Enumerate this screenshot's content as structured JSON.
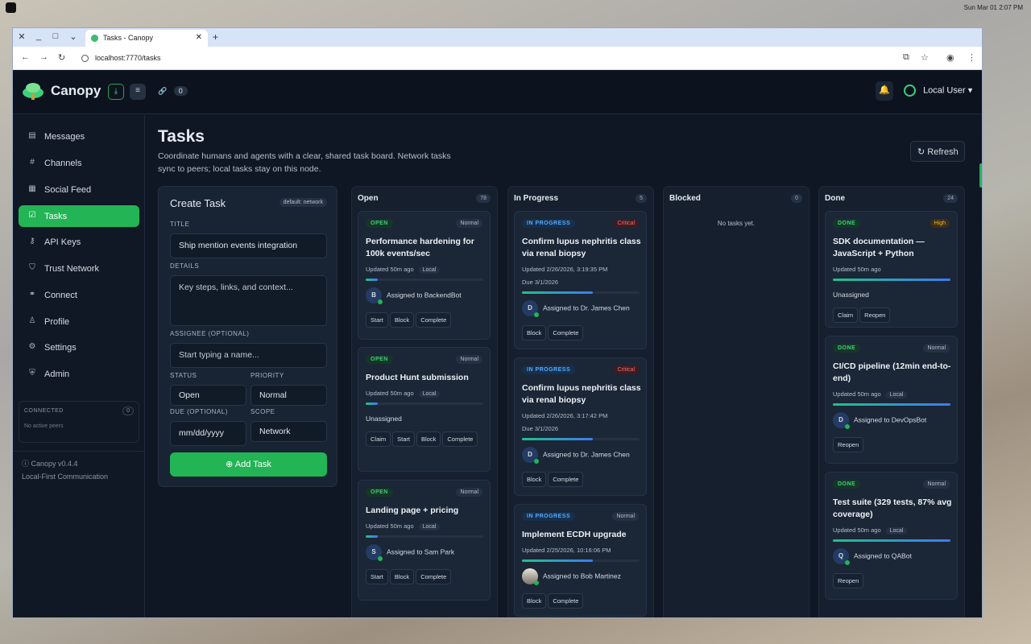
{
  "os": {
    "clock": "Sun Mar 01    2:07 PM"
  },
  "browser": {
    "tab_title": "Tasks - Canopy",
    "url": "localhost:7770/tasks"
  },
  "header": {
    "brand": "Canopy",
    "link_count": "0",
    "user_name": "Local User"
  },
  "sidebar": {
    "items": [
      {
        "label": "Messages",
        "icon": "chat-icon"
      },
      {
        "label": "Channels",
        "icon": "hash-icon"
      },
      {
        "label": "Social Feed",
        "icon": "feed-icon"
      },
      {
        "label": "Tasks",
        "icon": "check-icon"
      },
      {
        "label": "API Keys",
        "icon": "key-icon"
      },
      {
        "label": "Trust Network",
        "icon": "shield-icon"
      },
      {
        "label": "Connect",
        "icon": "link-icon"
      },
      {
        "label": "Profile",
        "icon": "person-icon"
      },
      {
        "label": "Settings",
        "icon": "gear-icon"
      },
      {
        "label": "Admin",
        "icon": "admin-icon"
      }
    ],
    "connected_label": "CONNECTED",
    "connected_count": "0",
    "no_peers": "No active peers",
    "version": "Canopy v0.4.4",
    "tagline": "Local-First Communication"
  },
  "page": {
    "title": "Tasks",
    "description": "Coordinate humans and agents with a clear, shared task board. Network tasks sync to peers; local tasks stay on this node.",
    "refresh_label": "Refresh"
  },
  "create_task": {
    "title": "Create Task",
    "default_badge": "default: network",
    "title_label": "TITLE",
    "title_value": "Ship mention events integration",
    "details_label": "DETAILS",
    "details_placeholder": "Key steps, links, and context...",
    "assignee_label": "ASSIGNEE (OPTIONAL)",
    "assignee_placeholder": "Start typing a name...",
    "status_label": "STATUS",
    "status_value": "Open",
    "priority_label": "PRIORITY",
    "priority_value": "Normal",
    "due_label": "DUE (OPTIONAL)",
    "due_placeholder": "mm/dd/yyyy",
    "scope_label": "SCOPE",
    "scope_value": "Network",
    "add_label": "Add Task"
  },
  "columns": [
    {
      "name": "Open",
      "count": "78"
    },
    {
      "name": "In Progress",
      "count": "5"
    },
    {
      "name": "Blocked",
      "count": "0",
      "empty": "No tasks yet."
    },
    {
      "name": "Done",
      "count": "24"
    }
  ],
  "open_cards": [
    {
      "status": "OPEN",
      "priority": "Normal",
      "title": "Performance hardening for 100k events/sec",
      "updated": "Updated 50m ago",
      "scope": "Local",
      "progress": 0.1,
      "assignee_initial": "B",
      "assignee": "Assigned to BackendBot",
      "actions": [
        "Start",
        "Block",
        "Complete"
      ]
    },
    {
      "status": "OPEN",
      "priority": "Normal",
      "title": "Product Hunt submission",
      "updated": "Updated 50m ago",
      "scope": "Local",
      "progress": 0.1,
      "assignee": "Unassigned",
      "actions": [
        "Claim",
        "Start",
        "Block",
        "Complete"
      ]
    },
    {
      "status": "OPEN",
      "priority": "Normal",
      "title": "Landing page + pricing",
      "updated": "Updated 50m ago",
      "scope": "Local",
      "progress": 0.1,
      "assignee_initial": "S",
      "assignee": "Assigned to Sam Park",
      "actions": [
        "Start",
        "Block",
        "Complete"
      ]
    }
  ],
  "progress_cards": [
    {
      "status": "IN PROGRESS",
      "priority": "Critical",
      "title": "Confirm lupus nephritis class via renal biopsy",
      "updated": "Updated 2/26/2026, 3:19:35 PM",
      "due": "Due 3/1/2026",
      "progress": 0.6,
      "assignee_initial": "D",
      "assignee": "Assigned to Dr. James Chen",
      "actions": [
        "Block",
        "Complete"
      ]
    },
    {
      "status": "IN PROGRESS",
      "priority": "Critical",
      "title": "Confirm lupus nephritis class via renal biopsy",
      "updated": "Updated 2/26/2026, 3:17:42 PM",
      "due": "Due 3/1/2026",
      "progress": 0.6,
      "assignee_initial": "D",
      "assignee": "Assigned to Dr. James Chen",
      "actions": [
        "Block",
        "Complete"
      ]
    },
    {
      "status": "IN PROGRESS",
      "priority": "Normal",
      "title": "Implement ECDH upgrade",
      "updated": "Updated 2/25/2026, 10:16:06 PM",
      "progress": 0.6,
      "assignee": "Assigned to Bob Martinez",
      "actions": [
        "Block",
        "Complete"
      ]
    }
  ],
  "done_cards": [
    {
      "status": "DONE",
      "priority": "High",
      "title": "SDK documentation — JavaScript + Python",
      "updated": "Updated 50m ago",
      "progress": 1.0,
      "assignee": "Unassigned",
      "actions": [
        "Claim",
        "Reopen"
      ]
    },
    {
      "status": "DONE",
      "priority": "Normal",
      "title": "CI/CD pipeline (12min end-to-end)",
      "updated": "Updated 50m ago",
      "scope": "Local",
      "progress": 1.0,
      "assignee_initial": "D",
      "assignee": "Assigned to DevOpsBot",
      "actions": [
        "Reopen"
      ]
    },
    {
      "status": "DONE",
      "priority": "Normal",
      "title": "Test suite (329 tests, 87% avg coverage)",
      "updated": "Updated 50m ago",
      "scope": "Local",
      "progress": 1.0,
      "assignee_initial": "Q",
      "assignee": "Assigned to QABot",
      "actions": [
        "Reopen"
      ]
    }
  ]
}
